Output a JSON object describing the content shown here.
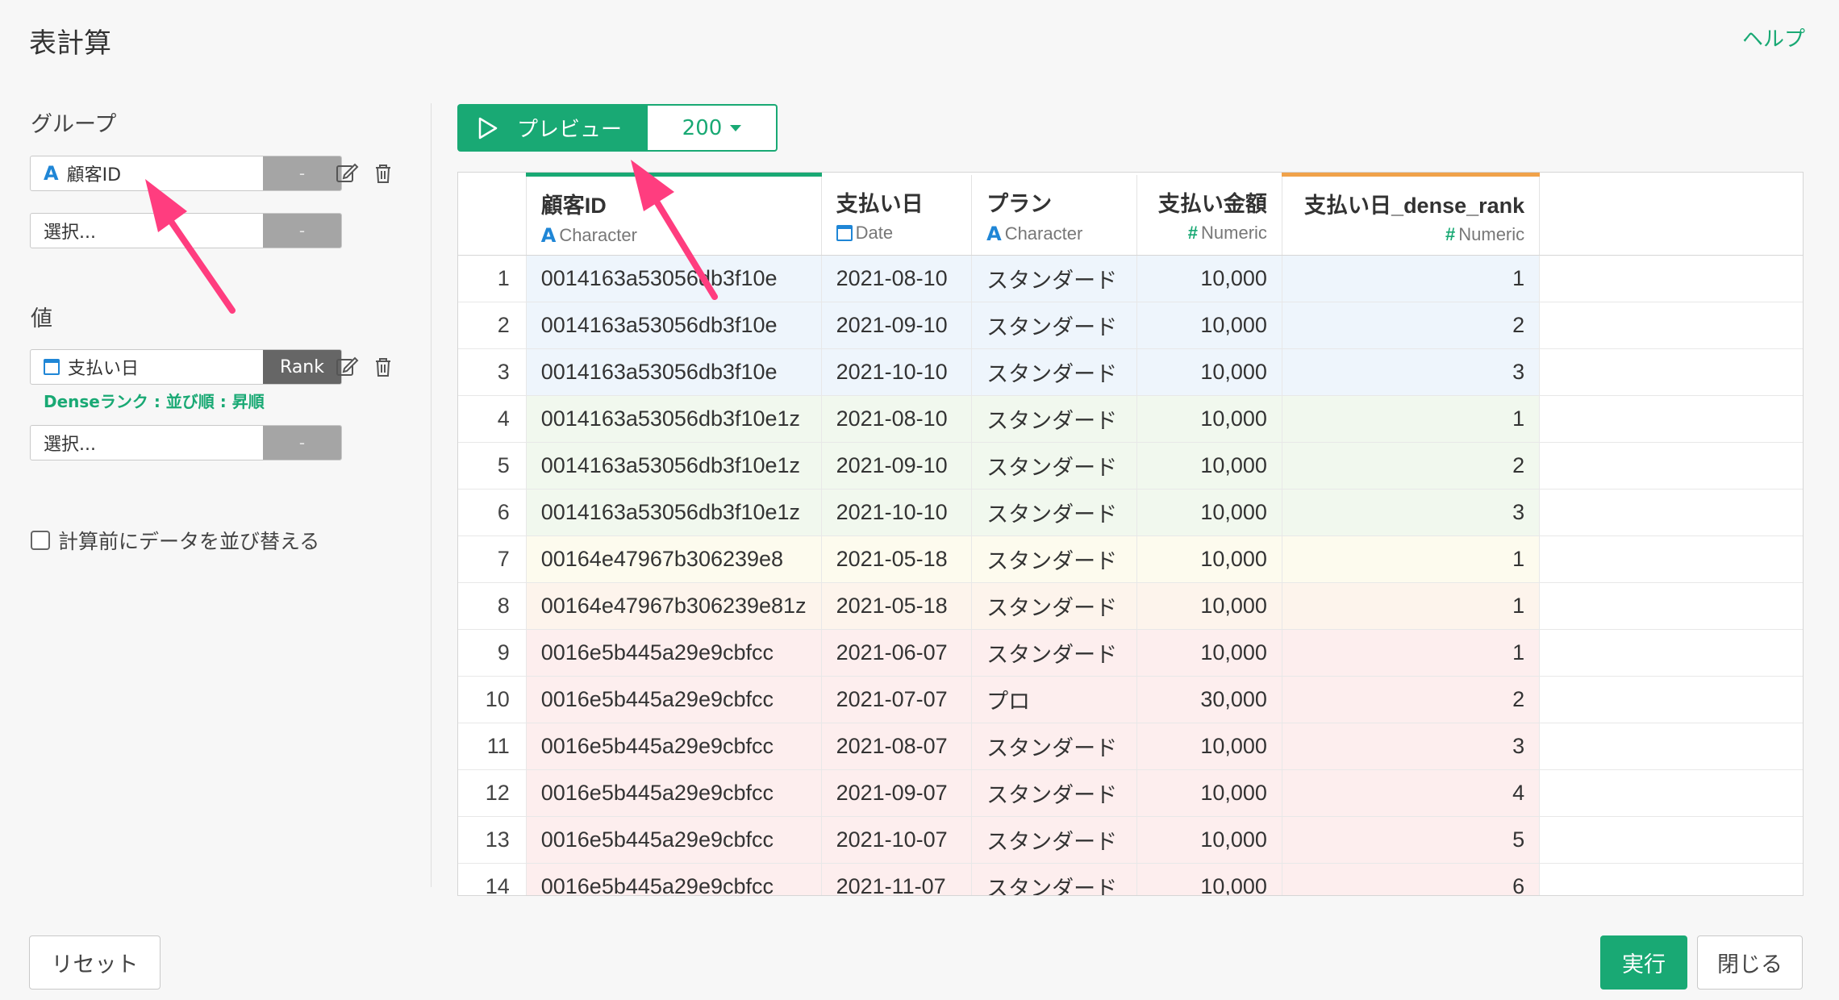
{
  "title": "表計算",
  "help_label": "ヘルプ",
  "group": {
    "label": "グループ",
    "selectors": [
      {
        "field": "顧客ID",
        "type_icon": "A",
        "op": "-"
      },
      {
        "field": "選択...",
        "op": "-"
      }
    ]
  },
  "value": {
    "label": "値",
    "selectors": [
      {
        "field": "支払い日",
        "type_icon": "calendar-icon",
        "op": "Rank"
      },
      {
        "field": "選択...",
        "op": "-"
      }
    ],
    "note": "Denseランク : 並び順 : 昇順"
  },
  "presort_label": "計算前にデータを並び替える",
  "preview": {
    "label": "プレビュー",
    "rows": "200"
  },
  "table": {
    "columns": [
      {
        "name": "顧客ID",
        "type": "Character",
        "type_icon": "A"
      },
      {
        "name": "支払い日",
        "type": "Date",
        "type_icon": "calendar-icon"
      },
      {
        "name": "プラン",
        "type": "Character",
        "type_icon": "A"
      },
      {
        "name": "支払い金額",
        "type": "Numeric",
        "type_icon": "#"
      },
      {
        "name": "支払い日_dense_rank",
        "type": "Numeric",
        "type_icon": "#"
      }
    ],
    "rows": [
      {
        "n": "1",
        "id": "0014163a53056db3f10e",
        "date": "2021-08-10",
        "plan": "スタンダード",
        "amount": "10,000",
        "rank": "1",
        "group": "blue"
      },
      {
        "n": "2",
        "id": "0014163a53056db3f10e",
        "date": "2021-09-10",
        "plan": "スタンダード",
        "amount": "10,000",
        "rank": "2",
        "group": "blue"
      },
      {
        "n": "3",
        "id": "0014163a53056db3f10e",
        "date": "2021-10-10",
        "plan": "スタンダード",
        "amount": "10,000",
        "rank": "3",
        "group": "blue"
      },
      {
        "n": "4",
        "id": "0014163a53056db3f10e1z",
        "date": "2021-08-10",
        "plan": "スタンダード",
        "amount": "10,000",
        "rank": "1",
        "group": "green"
      },
      {
        "n": "5",
        "id": "0014163a53056db3f10e1z",
        "date": "2021-09-10",
        "plan": "スタンダード",
        "amount": "10,000",
        "rank": "2",
        "group": "green"
      },
      {
        "n": "6",
        "id": "0014163a53056db3f10e1z",
        "date": "2021-10-10",
        "plan": "スタンダード",
        "amount": "10,000",
        "rank": "3",
        "group": "green"
      },
      {
        "n": "7",
        "id": "00164e47967b306239e8",
        "date": "2021-05-18",
        "plan": "スタンダード",
        "amount": "10,000",
        "rank": "1",
        "group": "yellow"
      },
      {
        "n": "8",
        "id": "00164e47967b306239e81z",
        "date": "2021-05-18",
        "plan": "スタンダード",
        "amount": "10,000",
        "rank": "1",
        "group": "orange"
      },
      {
        "n": "9",
        "id": "0016e5b445a29e9cbfcc",
        "date": "2021-06-07",
        "plan": "スタンダード",
        "amount": "10,000",
        "rank": "1",
        "group": "pink"
      },
      {
        "n": "10",
        "id": "0016e5b445a29e9cbfcc",
        "date": "2021-07-07",
        "plan": "プロ",
        "amount": "30,000",
        "rank": "2",
        "group": "pink"
      },
      {
        "n": "11",
        "id": "0016e5b445a29e9cbfcc",
        "date": "2021-08-07",
        "plan": "スタンダード",
        "amount": "10,000",
        "rank": "3",
        "group": "pink"
      },
      {
        "n": "12",
        "id": "0016e5b445a29e9cbfcc",
        "date": "2021-09-07",
        "plan": "スタンダード",
        "amount": "10,000",
        "rank": "4",
        "group": "pink"
      },
      {
        "n": "13",
        "id": "0016e5b445a29e9cbfcc",
        "date": "2021-10-07",
        "plan": "スタンダード",
        "amount": "10,000",
        "rank": "5",
        "group": "pink"
      },
      {
        "n": "14",
        "id": "0016e5b445a29e9cbfcc",
        "date": "2021-11-07",
        "plan": "スタンダード",
        "amount": "10,000",
        "rank": "6",
        "group": "pink"
      }
    ]
  },
  "footer": {
    "reset": "リセット",
    "run": "実行",
    "close": "閉じる"
  },
  "colors": {
    "accent": "#19a974",
    "new_column": "#f0a24a",
    "annotation_arrow": "#ff3d7f"
  }
}
